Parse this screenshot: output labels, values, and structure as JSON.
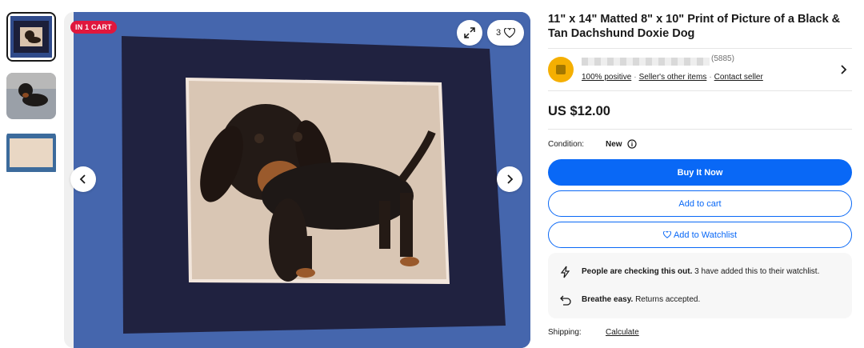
{
  "badge": "IN 1 CART",
  "watch_count": "3",
  "title": "11\" x 14\" Matted 8\" x 10\" Print of Picture of a Black & Tan Dachshund Doxie Dog",
  "seller": {
    "feedback_count": "(5885)",
    "positive": "100% positive",
    "other_items": "Seller's other items",
    "contact": "Contact seller"
  },
  "price": "US $12.00",
  "condition": {
    "label": "Condition:",
    "value": "New"
  },
  "buttons": {
    "buy": "Buy It Now",
    "cart": "Add to cart",
    "watch": "Add to Watchlist"
  },
  "info": {
    "checking_bold": "People are checking this out.",
    "checking_rest": "3 have added this to their watchlist.",
    "returns_bold": "Breathe easy.",
    "returns_rest": "Returns accepted."
  },
  "shipping": {
    "label": "Shipping:",
    "value": "Calculate"
  },
  "colors": {
    "accent": "#0968f6",
    "badge": "#e0173d",
    "avatar": "#f5af02"
  }
}
